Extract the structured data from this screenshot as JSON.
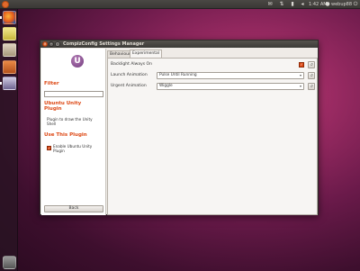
{
  "top_panel": {
    "time": "1:42 AM",
    "user": "webup88",
    "icons": [
      "ubuntu-logo",
      "envelope-icon",
      "network-icon",
      "battery-icon",
      "volume-icon",
      "power-icon"
    ]
  },
  "launcher": {
    "icons": [
      "firefox-icon",
      "notes-icon",
      "folder-icon",
      "office-icon",
      "settings-panel-icon",
      "trash-icon"
    ]
  },
  "window": {
    "title": "CompizConfig Settings Manager",
    "logo_letter": "U",
    "left_pane": {
      "filter_heading": "Filter",
      "filter_value": "",
      "plugin_name": "Ubuntu Unity Plugin",
      "plugin_description": "Plugin to draw the Unity Shell",
      "use_heading": "Use This Plugin",
      "enable_label": "Enable Ubuntu Unity Plugin",
      "enable_checked": true,
      "back_label": "Back"
    },
    "tabs": [
      {
        "label": "Behaviour",
        "active": false
      },
      {
        "label": "Experimental",
        "active": true
      }
    ],
    "settings": [
      {
        "label": "Backlight Always On",
        "type": "checkbox",
        "checked": true
      },
      {
        "label": "Launch Animation",
        "type": "select",
        "value": "Pulse Until Running"
      },
      {
        "label": "Urgent Animation",
        "type": "select",
        "value": "Wiggle"
      }
    ]
  },
  "colors": {
    "accent": "#dd4814",
    "panel": "#3c3b37",
    "window_bg": "#efebe7"
  }
}
